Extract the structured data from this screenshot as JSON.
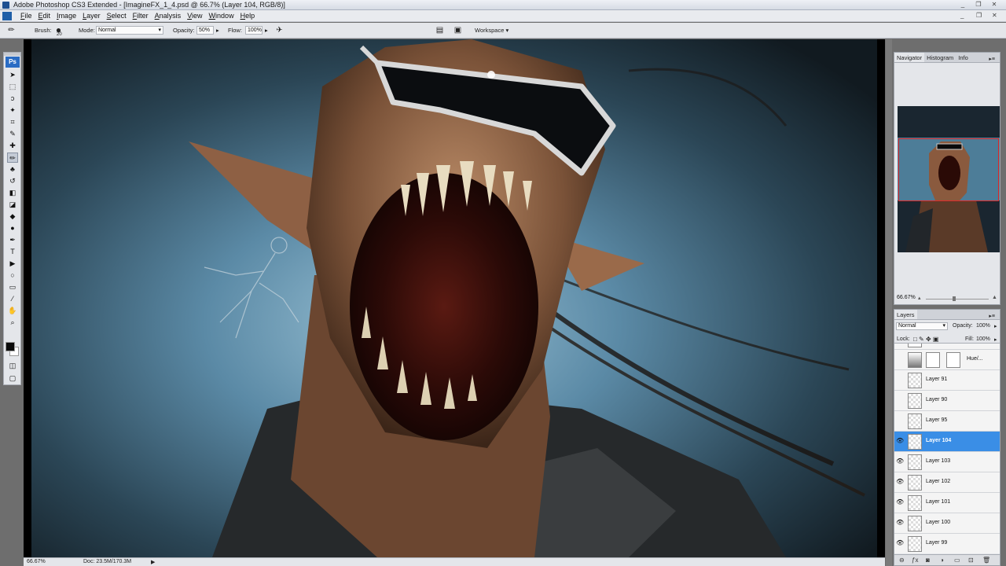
{
  "window": {
    "title": "Adobe Photoshop CS3 Extended - [ImagineFX_1_4.psd @ 66.7% (Layer 104, RGB/8)]",
    "minimize": "_",
    "restore": "❐",
    "close": "✕"
  },
  "menu": {
    "logo": "Ps",
    "items": [
      "File",
      "Edit",
      "Image",
      "Layer",
      "Select",
      "Filter",
      "Analysis",
      "View",
      "Window",
      "Help"
    ],
    "doc_controls": [
      "_",
      "❐",
      "✕"
    ]
  },
  "options": {
    "brush_label": "Brush:",
    "brush_size": "20",
    "mode_label": "Mode:",
    "mode_value": "Normal",
    "opacity_label": "Opacity:",
    "opacity_value": "50%",
    "flow_label": "Flow:",
    "flow_value": "100%",
    "workspace_label": "Workspace"
  },
  "toolbar": {
    "logo": "Ps",
    "tools": [
      {
        "icon": "move-icon",
        "glyph": "➤"
      },
      {
        "icon": "marquee-icon",
        "glyph": "⬚"
      },
      {
        "icon": "lasso-icon",
        "glyph": "ↄ"
      },
      {
        "icon": "magic-wand-icon",
        "glyph": "✦"
      },
      {
        "icon": "crop-icon",
        "glyph": "⌗"
      },
      {
        "icon": "slice-icon",
        "glyph": "✎"
      },
      {
        "icon": "healing-brush-icon",
        "glyph": "✚"
      },
      {
        "icon": "brush-icon",
        "glyph": "✏"
      },
      {
        "icon": "clone-stamp-icon",
        "glyph": "♣"
      },
      {
        "icon": "history-brush-icon",
        "glyph": "↺"
      },
      {
        "icon": "eraser-icon",
        "glyph": "◧"
      },
      {
        "icon": "paint-bucket-icon",
        "glyph": "◪"
      },
      {
        "icon": "blur-icon",
        "glyph": "◆"
      },
      {
        "icon": "dodge-icon",
        "glyph": "●"
      },
      {
        "icon": "pen-icon",
        "glyph": "✒"
      },
      {
        "icon": "type-icon",
        "glyph": "T"
      },
      {
        "icon": "path-selection-icon",
        "glyph": "▶"
      },
      {
        "icon": "shape-icon",
        "glyph": "○"
      },
      {
        "icon": "notes-icon",
        "glyph": "▭"
      },
      {
        "icon": "eyedropper-icon",
        "glyph": "⁄"
      },
      {
        "icon": "hand-icon",
        "glyph": "✋"
      },
      {
        "icon": "zoom-icon",
        "glyph": "⌕"
      }
    ],
    "fg_color": "#0a0a0a",
    "bg_color": "#ffffff"
  },
  "status": {
    "zoom": "66.67%",
    "doc": "Doc: 23.5M/170.3M"
  },
  "navigator": {
    "tabs": [
      "Navigator",
      "Histogram",
      "Info"
    ],
    "zoom": "66.67%",
    "view_frame_color": "#e02828"
  },
  "layers": {
    "tab": "Layers",
    "blend_mode": "Normal",
    "opacity_label": "Opacity:",
    "opacity_value": "100%",
    "lock_label": "Lock:",
    "fill_label": "Fill:",
    "fill_value": "100%",
    "adjustment_name": "Hue/...",
    "items": [
      {
        "name": "Layer 91",
        "visible": false,
        "selected": false
      },
      {
        "name": "Layer 90",
        "visible": false,
        "selected": false
      },
      {
        "name": "Layer 95",
        "visible": false,
        "selected": false
      },
      {
        "name": "Layer 104",
        "visible": true,
        "selected": true
      },
      {
        "name": "Layer 103",
        "visible": true,
        "selected": false
      },
      {
        "name": "Layer 102",
        "visible": true,
        "selected": false
      },
      {
        "name": "Layer 101",
        "visible": true,
        "selected": false
      },
      {
        "name": "Layer 100",
        "visible": true,
        "selected": false
      },
      {
        "name": "Layer 99",
        "visible": true,
        "selected": false
      }
    ],
    "selected_color": "#3a8ee6"
  }
}
